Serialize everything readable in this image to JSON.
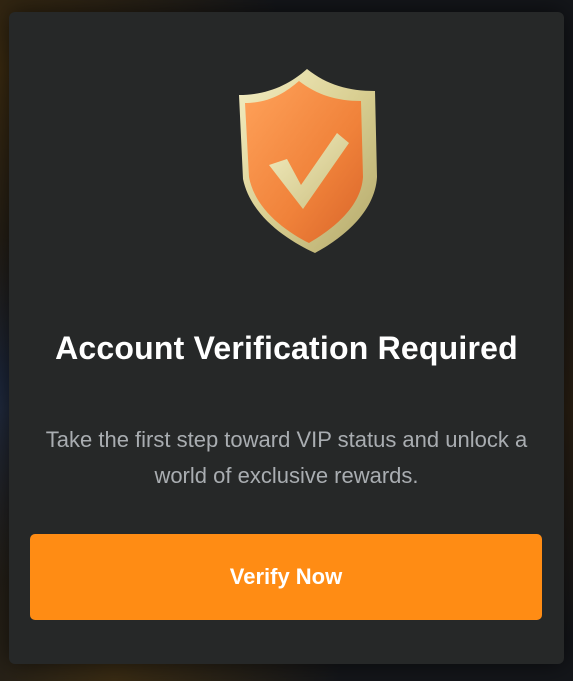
{
  "modal": {
    "title": "Account Verification Required",
    "description": "Take the first step toward VIP status and unlock a world of exclusive rewards.",
    "cta_label": "Verify Now",
    "icon": "shield-check-icon"
  },
  "colors": {
    "modal_background": "#262828",
    "accent": "#ff8c14",
    "title_text": "#ffffff",
    "body_text": "#a9adb1",
    "shield_face": "#f28a3f",
    "shield_rim": "#e3dba6"
  }
}
